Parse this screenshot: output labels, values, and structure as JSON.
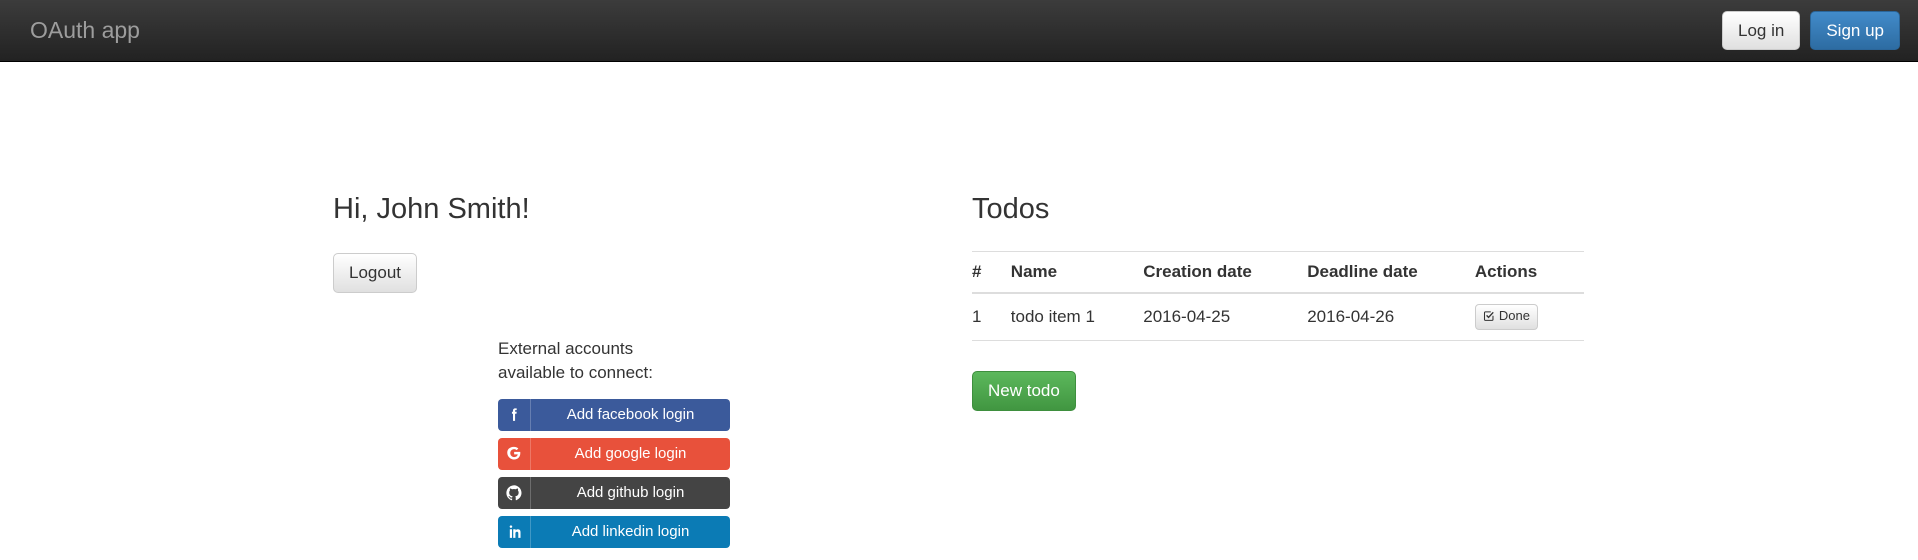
{
  "navbar": {
    "brand": "OAuth app",
    "login_label": "Log in",
    "signup_label": "Sign up",
    "background_start": "#3c3c3c",
    "background_end": "#222222",
    "brand_color": "#9d9d9d",
    "primary_color": "#428bca"
  },
  "account": {
    "greeting": "Hi, John Smith!",
    "logout_label": "Logout",
    "external_label": "External accounts available to connect:",
    "providers": [
      {
        "name": "facebook",
        "label": "Add facebook login",
        "icon": "facebook-icon",
        "color": "#3b5a9b"
      },
      {
        "name": "google",
        "label": "Add google login",
        "icon": "google-icon",
        "color": "#e8513b"
      },
      {
        "name": "github",
        "label": "Add github login",
        "icon": "github-icon",
        "color": "#444444"
      },
      {
        "name": "linkedin",
        "label": "Add linkedin login",
        "icon": "linkedin-icon",
        "color": "#0b7bb5"
      }
    ]
  },
  "todos": {
    "title": "Todos",
    "columns": [
      "#",
      "Name",
      "Creation date",
      "Deadline date",
      "Actions"
    ],
    "rows": [
      {
        "num": "1",
        "name": "todo item 1",
        "creation_date": "2016-04-25",
        "deadline_date": "2016-04-26",
        "action_label": "Done",
        "action_icon": "check-square-icon"
      }
    ],
    "new_todo_label": "New todo",
    "new_todo_color": "#5cb85c"
  }
}
